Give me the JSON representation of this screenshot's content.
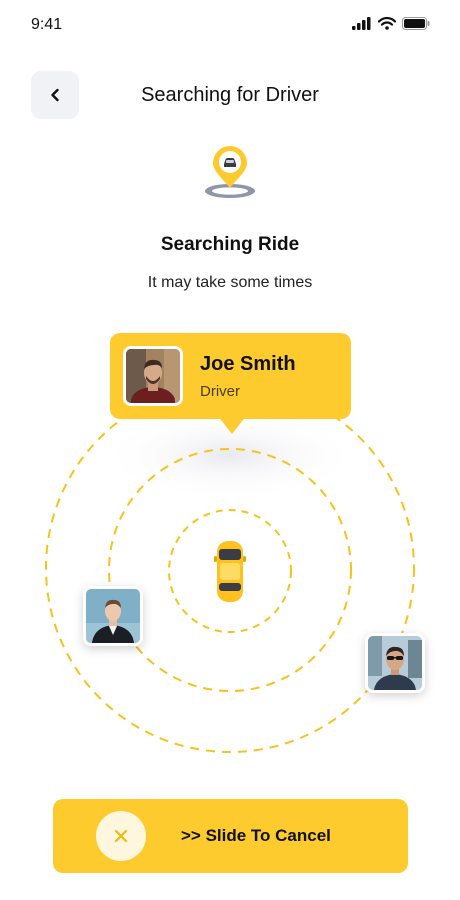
{
  "status_bar": {
    "time": "9:41",
    "signal_icon": "signal-icon",
    "wifi_icon": "wifi-icon",
    "battery_icon": "battery-icon"
  },
  "header": {
    "back_icon": "chevron-left-icon",
    "title": "Searching for Driver"
  },
  "search": {
    "icon": "car-location-pin-icon",
    "heading": "Searching Ride",
    "subtitle": "It may take some times"
  },
  "driver": {
    "name": "Joe Smith",
    "role": "Driver"
  },
  "nearby": {
    "car_icon": "yellow-car-icon"
  },
  "cancel": {
    "icon": "close-icon",
    "label": ">> Slide To Cancel"
  },
  "colors": {
    "accent": "#fecb2f",
    "back_button_bg": "#f1f2f6",
    "knob_bg": "#fff7dd",
    "dashed_ring": "#f7c21b"
  }
}
